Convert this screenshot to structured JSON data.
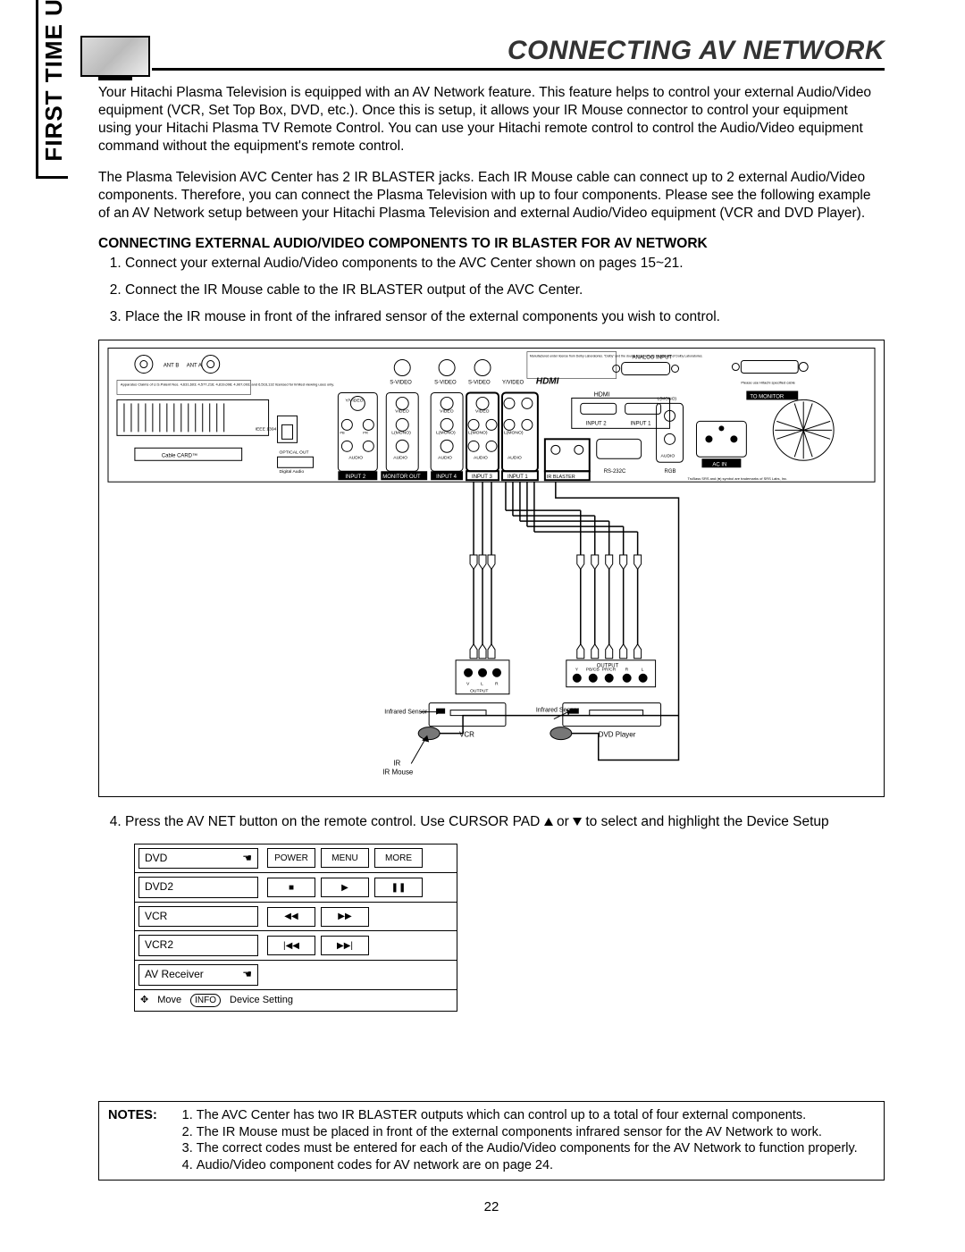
{
  "header": {
    "title": "CONNECTING AV NETWORK"
  },
  "side_tab": "FIRST TIME USE",
  "intro": {
    "p1": "Your Hitachi Plasma Television is equipped with an AV Network feature. This feature helps to control your external Audio/Video equipment (VCR, Set Top Box, DVD, etc.). Once this is setup, it allows your IR Mouse connector to control your equipment using your Hitachi Plasma TV Remote Control. You can use your Hitachi remote control to control the Audio/Video equipment command without the equipment's remote control.",
    "p2": "The Plasma Television AVC Center has 2 IR BLASTER jacks. Each IR Mouse cable can connect up to 2 external Audio/Video components. Therefore, you can connect the Plasma Television with up to four components. Please see the following example of an AV Network setup between your Hitachi Plasma Television and external Audio/Video equipment (VCR and DVD Player)."
  },
  "subheading": "CONNECTING EXTERNAL AUDIO/VIDEO COMPONENTS TO IR BLASTER FOR AV NETWORK",
  "steps": {
    "s1": "Connect your external Audio/Video components to the AVC Center shown on pages 15~21.",
    "s2": "Connect the IR Mouse cable to the IR BLASTER output of the AVC Center.",
    "s3": "Place the IR mouse in front of the infrared sensor of the external components you wish to control.",
    "s4_a": "Press the AV NET button on the remote control.  Use CURSOR PAD ",
    "s4_b": " or ",
    "s4_c": " to select and highlight the Device Setup"
  },
  "diagram": {
    "rear_labels": {
      "ant_b": "ANT B",
      "ant_a": "ANT A",
      "svideo": "S-VIDEO",
      "svideo2": "S-VIDEO",
      "yvideo_hdmi": "Y/VIDEO",
      "hdmi_logo": "HDMI",
      "hdmi_text": "HDMI",
      "analog_input": "ANALOG INPUT",
      "to_monitor": "TO MONITOR",
      "video": "VIDEO",
      "lmono": "L(MONO)",
      "audio": "AUDIO",
      "input1": "INPUT 1",
      "input2": "INPUT 2",
      "input3": "INPUT 3",
      "input4": "INPUT 4",
      "monitor_out": "MONITOR OUT",
      "ir_blaster": "IR BLASTER",
      "rs232c": "RS-232C",
      "rgb": "RGB",
      "ac_in": "AC IN",
      "pb": "PB",
      "pr": "PR",
      "cablecard": "Cable CARD™",
      "optical": "OPTICAL OUT",
      "digital_audio": "Digital Audio",
      "dolby": "Manufactured under license from Dolby Laboratories. \"Dolby\" and the double-D symbol are trademarks of Dolby Laboratories.",
      "hitachi_cable": "Please use Hitachi specified cable",
      "trubass": "TruBass SRS and (●) symbol are trademarks of SRS Labs, Inc.",
      "apparatus": "Apparatus Claims of U.S.Patent Nos. 4,631,603; 4,577,216; 4,819,098; 4,907,093; and 6,516,132 licensed for limited viewing uses only.",
      "ieee": "IEEE 1394"
    },
    "lower": {
      "output": "OUTPUT",
      "y": "Y",
      "pbcb": "PB/CB",
      "prcr": "PR/CR",
      "r": "R",
      "l": "L",
      "v": "V",
      "output2": "OUTPUT",
      "infrared_sensor": "Infrared Sensor",
      "vcr": "VCR",
      "dvd_player": "DVD Player",
      "ir_mouse": "IR Mouse"
    }
  },
  "avnet_panel": {
    "rows": [
      {
        "label": "DVD",
        "hand": true,
        "buttons": [
          "POWER",
          "MENU",
          "MORE"
        ]
      },
      {
        "label": "DVD2",
        "hand": false,
        "buttons": [
          "■",
          "▶",
          "❚❚"
        ]
      },
      {
        "label": "VCR",
        "hand": false,
        "buttons": [
          "◀◀",
          "▶▶"
        ]
      },
      {
        "label": "VCR2",
        "hand": false,
        "buttons": [
          "|◀◀",
          "▶▶|"
        ]
      },
      {
        "label": "AV Receiver",
        "hand": true,
        "buttons": []
      }
    ],
    "footer_move": "Move",
    "footer_info": "INFO",
    "footer_setting": "Device Setting"
  },
  "notes": {
    "label": "NOTES:",
    "items": [
      "The AVC Center has two IR BLASTER outputs which can control up to a total of four external components.",
      "The IR Mouse must be placed in front of the external components infrared sensor for the AV Network to work.",
      "The correct codes must be entered for each of the Audio/Video components for the AV Network to function properly.",
      "Audio/Video component codes for AV network are on page 24."
    ]
  },
  "page_number": "22"
}
